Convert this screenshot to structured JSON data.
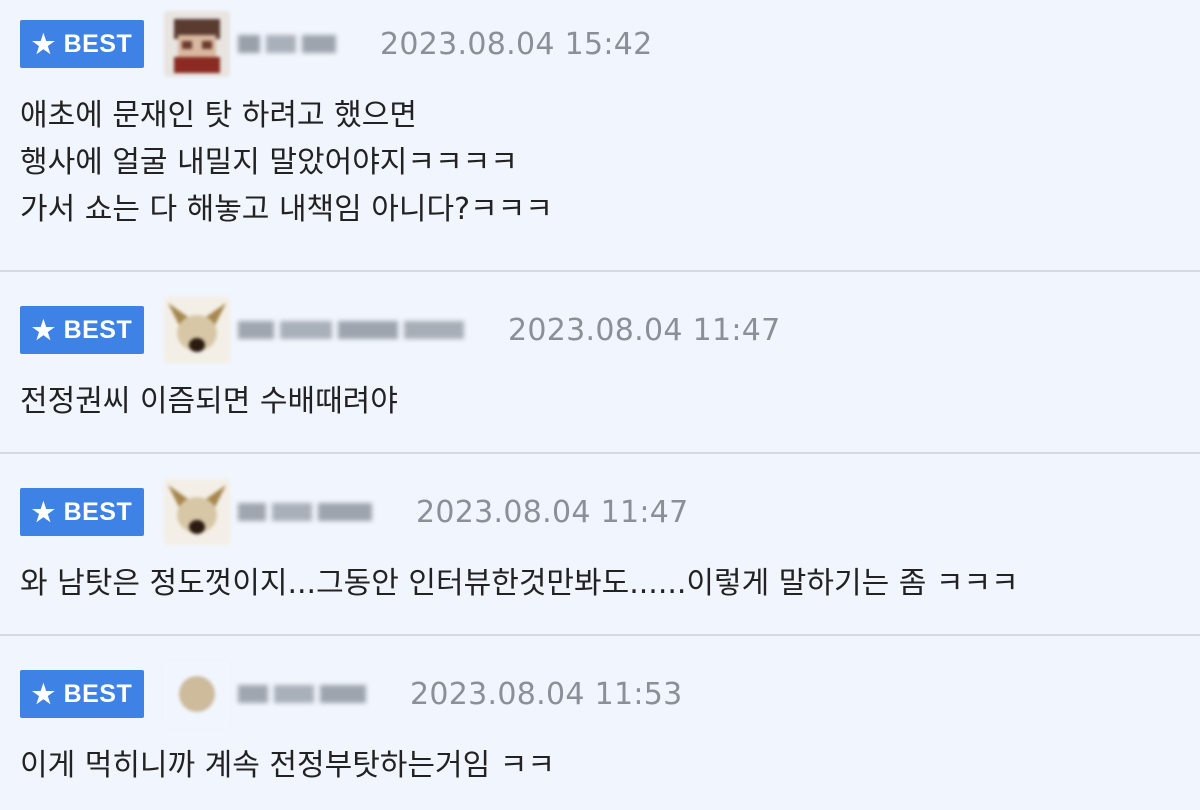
{
  "badge_label": "BEST",
  "comments": [
    {
      "date": "2023.08.04 15:42",
      "lines": [
        "애초에 문재인 탓 하려고 했으면",
        "행사에 얼굴 내밀지 말았어야지ㅋㅋㅋㅋ",
        "가서 쇼는 다 해놓고 내책임 아니다?ㅋㅋㅋ"
      ]
    },
    {
      "date": "2023.08.04 11:47",
      "lines": [
        "전정권씨 이즘되면 수배때려야"
      ]
    },
    {
      "date": "2023.08.04 11:47",
      "lines": [
        "와 남탓은 정도껏이지...그동안 인터뷰한것만봐도......이렇게 말하기는 좀 ㅋㅋㅋ"
      ]
    },
    {
      "date": "2023.08.04 11:53",
      "lines": [
        "이게 먹히니까 계속 전정부탓하는거임 ㅋㅋ"
      ]
    }
  ],
  "colors": {
    "badge": "#3d82e4",
    "background": "#f1f5fd",
    "divider": "#d4d9e2",
    "date_text": "#8a8f98"
  }
}
